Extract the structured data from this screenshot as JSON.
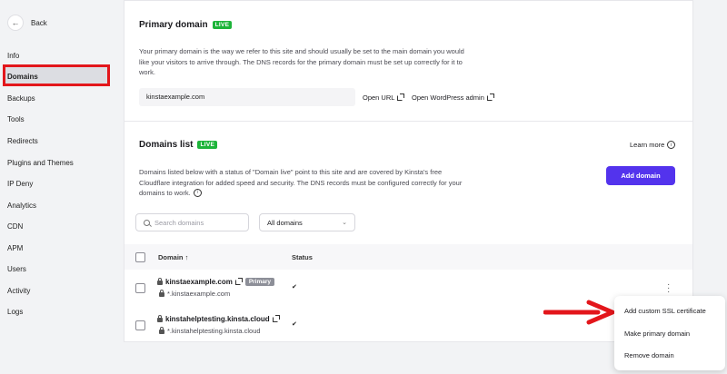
{
  "sidebar": {
    "back_label": "Back",
    "items": [
      {
        "label": "Info"
      },
      {
        "label": "Domains",
        "active": true
      },
      {
        "label": "Backups"
      },
      {
        "label": "Tools"
      },
      {
        "label": "Redirects"
      },
      {
        "label": "Plugins and Themes"
      },
      {
        "label": "IP Deny"
      },
      {
        "label": "Analytics"
      },
      {
        "label": "CDN"
      },
      {
        "label": "APM"
      },
      {
        "label": "Users"
      },
      {
        "label": "Activity"
      },
      {
        "label": "Logs"
      }
    ]
  },
  "primary": {
    "title": "Primary domain",
    "badge": "LIVE",
    "description_line1": "Your primary domain is the way we refer to this site and should usually be set to the main domain you would",
    "description_line2": "like your visitors to arrive through. The DNS records for the primary domain must be set up correctly for it to",
    "description_line3": "work.",
    "domain_value": "kinstaexample.com",
    "open_url": "Open URL",
    "open_wp_admin": "Open WordPress admin"
  },
  "domains_list": {
    "title": "Domains list",
    "badge": "LIVE",
    "learn_more": "Learn more",
    "description_line1": "Domains listed below with a status of \"Domain live\" point to this site and are covered by Kinsta's free",
    "description_line2": "Cloudflare integration for added speed and security. The DNS records must be configured correctly for your",
    "description_line3": "domains to work.",
    "add_domain": "Add domain",
    "search_placeholder": "Search domains",
    "filter_value": "All domains",
    "col_domain": "Domain ↑",
    "col_status": "Status",
    "rows": [
      {
        "domain": "kinstaexample.com",
        "badge": "Primary",
        "wildcard": "*.kinstaexample.com",
        "status": "✔"
      },
      {
        "domain": "kinstahelptesting.kinsta.cloud",
        "wildcard": "*.kinstahelptesting.kinsta.cloud",
        "status": "✔"
      }
    ]
  },
  "menu": {
    "items": [
      "Add custom SSL certificate",
      "Make primary domain",
      "Remove domain"
    ]
  },
  "colors": {
    "accent": "#5333ed",
    "live_green": "#1db43a",
    "highlight_red": "#e3161b"
  }
}
